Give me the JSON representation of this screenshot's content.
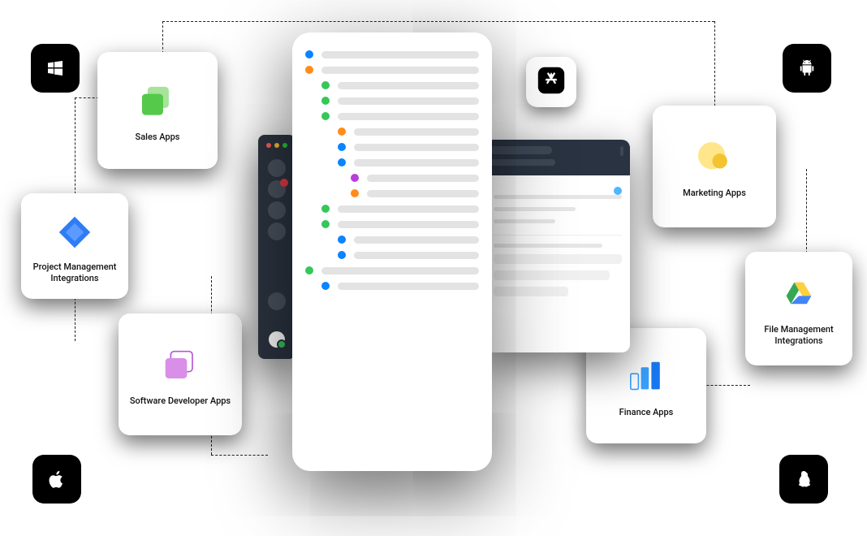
{
  "categories": {
    "sales": {
      "label": "Sales Apps"
    },
    "pm": {
      "label": "Project Management Integrations"
    },
    "dev": {
      "label": "Software Developer Apps"
    },
    "marketing": {
      "label": "Marketing Apps"
    },
    "finance": {
      "label": "Finance Apps"
    },
    "file": {
      "label": "File Management Integrations"
    }
  },
  "platforms": {
    "windows": "windows",
    "apple": "apple",
    "android": "android",
    "linux": "linux"
  },
  "list_rows": [
    {
      "color": "blue",
      "indent": 0
    },
    {
      "color": "orange",
      "indent": 0
    },
    {
      "color": "green",
      "indent": 1
    },
    {
      "color": "green",
      "indent": 1
    },
    {
      "color": "green",
      "indent": 1
    },
    {
      "color": "orange",
      "indent": 2
    },
    {
      "color": "blue",
      "indent": 2
    },
    {
      "color": "blue",
      "indent": 2
    },
    {
      "color": "purple",
      "indent": 3
    },
    {
      "color": "orange",
      "indent": 3
    },
    {
      "color": "green",
      "indent": 1
    },
    {
      "color": "green",
      "indent": 1
    },
    {
      "color": "blue",
      "indent": 2
    },
    {
      "color": "blue",
      "indent": 2
    },
    {
      "color": "green",
      "indent": 0
    },
    {
      "color": "blue",
      "indent": 1
    }
  ],
  "colors": {
    "blue": "#0a84ff",
    "orange": "#ff8c1a",
    "green": "#35c759",
    "purple": "#b83ddb"
  }
}
